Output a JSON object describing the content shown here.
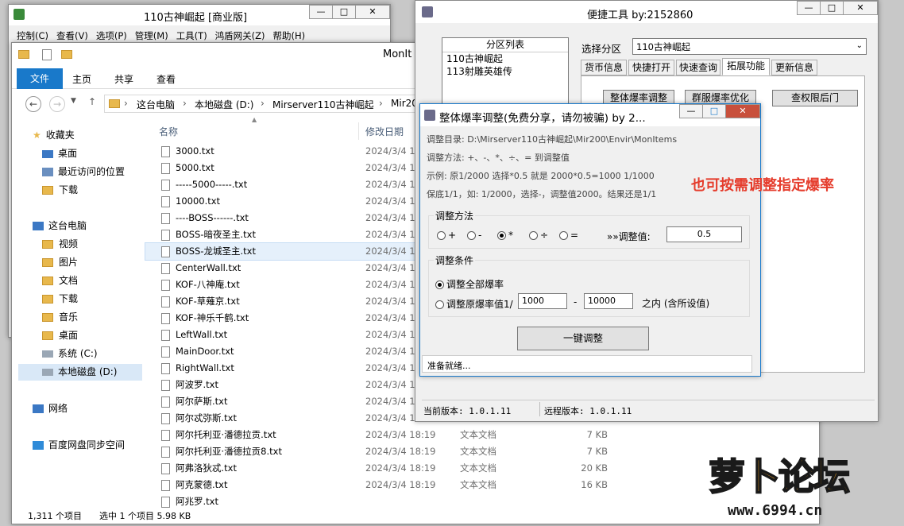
{
  "back_window": {
    "title": "110古神崛起 [商业版]",
    "menu": [
      "控制(C)",
      "查看(V)",
      "选项(P)",
      "管理(M)",
      "工具(T)",
      "鸿盾网关(Z)",
      "帮助(H)"
    ]
  },
  "explorer": {
    "title": "MonIt",
    "ribbon_tabs": [
      "文件",
      "主页",
      "共享",
      "查看"
    ],
    "path": [
      "这台电脑",
      "本地磁盘 (D:)",
      "Mirserver110古神崛起",
      "Mir20"
    ],
    "col_name": "名称",
    "col_date": "修改日期",
    "nav": [
      {
        "label": "收藏夹",
        "icon": "star-icon"
      },
      {
        "label": "桌面",
        "icon": "desktop-icon"
      },
      {
        "label": "最近访问的位置",
        "icon": "recent-icon"
      },
      {
        "label": "下载",
        "icon": "download-icon"
      },
      {
        "label": "这台电脑",
        "icon": "computer-icon"
      },
      {
        "label": "视频",
        "icon": "folder-icon"
      },
      {
        "label": "图片",
        "icon": "folder-icon"
      },
      {
        "label": "文档",
        "icon": "folder-icon"
      },
      {
        "label": "下载",
        "icon": "folder-icon"
      },
      {
        "label": "音乐",
        "icon": "folder-icon"
      },
      {
        "label": "桌面",
        "icon": "folder-icon"
      },
      {
        "label": "系统 (C:)",
        "icon": "drive-icon"
      },
      {
        "label": "本地磁盘 (D:)",
        "icon": "drive-icon"
      },
      {
        "label": "网络",
        "icon": "network-icon"
      },
      {
        "label": "百度网盘同步空间",
        "icon": "cloud-icon"
      }
    ],
    "files": [
      {
        "name": "3000.txt",
        "date": "2024/3/4 1",
        "type": "",
        "size": ""
      },
      {
        "name": "5000.txt",
        "date": "2024/3/4 1",
        "type": "",
        "size": ""
      },
      {
        "name": "-----5000-----.txt",
        "date": "2024/3/4 1",
        "type": "",
        "size": ""
      },
      {
        "name": "10000.txt",
        "date": "2024/3/4 1",
        "type": "",
        "size": ""
      },
      {
        "name": "----BOSS------.txt",
        "date": "2024/3/4 1",
        "type": "",
        "size": ""
      },
      {
        "name": "BOSS-暗夜圣主.txt",
        "date": "2024/3/4 1",
        "type": "",
        "size": ""
      },
      {
        "name": "BOSS-龙城圣主.txt",
        "date": "2024/3/4 1",
        "type": "",
        "size": ""
      },
      {
        "name": "CenterWall.txt",
        "date": "2024/3/4 1",
        "type": "",
        "size": ""
      },
      {
        "name": "KOF-八神庵.txt",
        "date": "2024/3/4 1",
        "type": "",
        "size": ""
      },
      {
        "name": "KOF-草薙京.txt",
        "date": "2024/3/4 1",
        "type": "",
        "size": ""
      },
      {
        "name": "KOF-神乐千鹤.txt",
        "date": "2024/3/4 1",
        "type": "",
        "size": ""
      },
      {
        "name": "LeftWall.txt",
        "date": "2024/3/4 1",
        "type": "",
        "size": ""
      },
      {
        "name": "MainDoor.txt",
        "date": "2024/3/4 1",
        "type": "",
        "size": ""
      },
      {
        "name": "RightWall.txt",
        "date": "2024/3/4 1",
        "type": "",
        "size": ""
      },
      {
        "name": "阿波罗.txt",
        "date": "2024/3/4 1",
        "type": "",
        "size": ""
      },
      {
        "name": "阿尔萨斯.txt",
        "date": "2024/3/4 1",
        "type": "",
        "size": ""
      },
      {
        "name": "阿尔忒弥斯.txt",
        "date": "2024/3/4 1",
        "type": "",
        "size": ""
      },
      {
        "name": "阿尔托利亚·潘德拉贡.txt",
        "date": "2024/3/4 18:19",
        "type": "文本文档",
        "size": "7 KB"
      },
      {
        "name": "阿尔托利亚·潘德拉贡8.txt",
        "date": "2024/3/4 18:19",
        "type": "文本文档",
        "size": "7 KB"
      },
      {
        "name": "阿弗洛狄忒.txt",
        "date": "2024/3/4 18:19",
        "type": "文本文档",
        "size": "20 KB"
      },
      {
        "name": "阿克蒙德.txt",
        "date": "2024/3/4 18:19",
        "type": "文本文档",
        "size": "16 KB"
      },
      {
        "name": "阿兆罗.txt",
        "date": "",
        "type": "",
        "size": ""
      }
    ],
    "status_count": "1,311 个项目",
    "status_selected": "选中 1 个项目  5.98 KB"
  },
  "tool": {
    "title": "便捷工具 by:2152860",
    "zone_list_header": "分区列表",
    "zones": [
      "110古神崛起",
      "113射雕英雄传"
    ],
    "select_label": "选择分区",
    "select_value": "110古神崛起",
    "tabs": [
      "货币信息",
      "快捷打开",
      "快速查询",
      "拓展功能",
      "更新信息"
    ],
    "buttons": [
      "整体爆率调整",
      "群服爆率优化",
      "查权限后门"
    ],
    "current_version": "当前版本: 1.0.1.11",
    "remote_version": "远程版本: 1.0.1.11"
  },
  "dialog": {
    "title": "整体爆率调整(免费分享，请勿被骗)   by 2...",
    "dir": "调整目录: D:\\Mirserver110古神崛起\\Mir200\\Envir\\MonItems",
    "method": "调整方法: +、-、*、÷、=   到调整值",
    "example": "示例: 原1/2000 选择*0.5 就是 2000*0.5=1000  1/1000",
    "floor": "保底1/1，如: 1/2000，选择-，调整值2000。结果还是1/1",
    "method_group": "调整方法",
    "ops": [
      "+",
      "-",
      "*",
      "÷",
      "="
    ],
    "adjust_label": "»»调整值:",
    "adjust_value": "0.5",
    "cond_group": "调整条件",
    "cond_all": "调整全部爆率",
    "cond_range": "调整原爆率值1/",
    "range_from": "1000",
    "range_dash": "-",
    "range_to": "10000",
    "range_suffix": "之内 (含所设值)",
    "run_button": "一键调整",
    "status": "准备就绪..."
  },
  "annotation": "也可按需调整指定爆率",
  "watermark": {
    "text": "萝卜论坛",
    "url": "www.6994.cn"
  }
}
